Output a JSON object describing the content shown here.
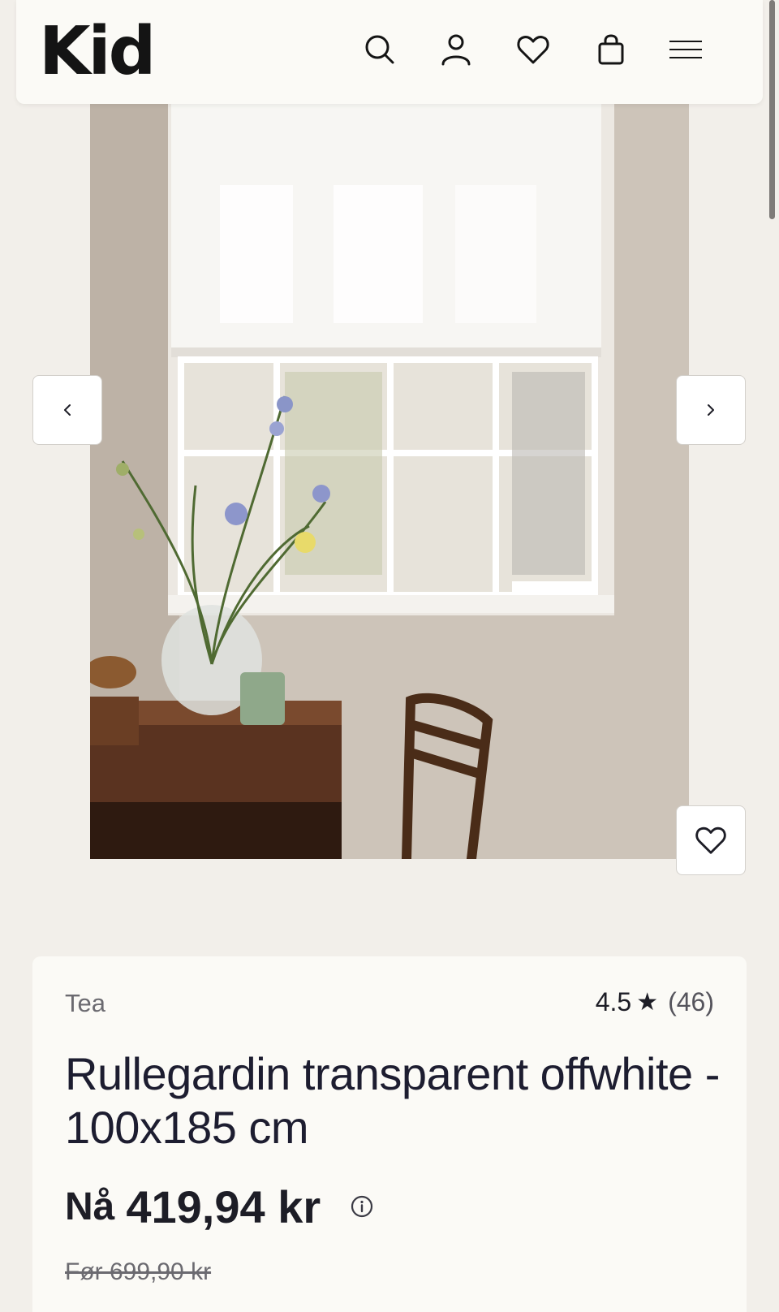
{
  "header": {
    "logo": "Kid",
    "icons": [
      "search-icon",
      "account-icon",
      "heart-icon",
      "bag-icon",
      "menu-icon"
    ]
  },
  "gallery": {
    "prev_label": "‹",
    "next_label": "›"
  },
  "product": {
    "brand": "Tea",
    "rating": "4.5",
    "rating_star": "★",
    "review_count": "(46)",
    "title": "Rullegardin transparent offwhite - 100x185 cm",
    "price_prefix": "Nå",
    "price": "419,94 kr",
    "old_price": "Før 699,90 kr"
  },
  "colors": {
    "background": "#f2efea",
    "card": "#fbfaf6",
    "text": "#1d1d26"
  }
}
